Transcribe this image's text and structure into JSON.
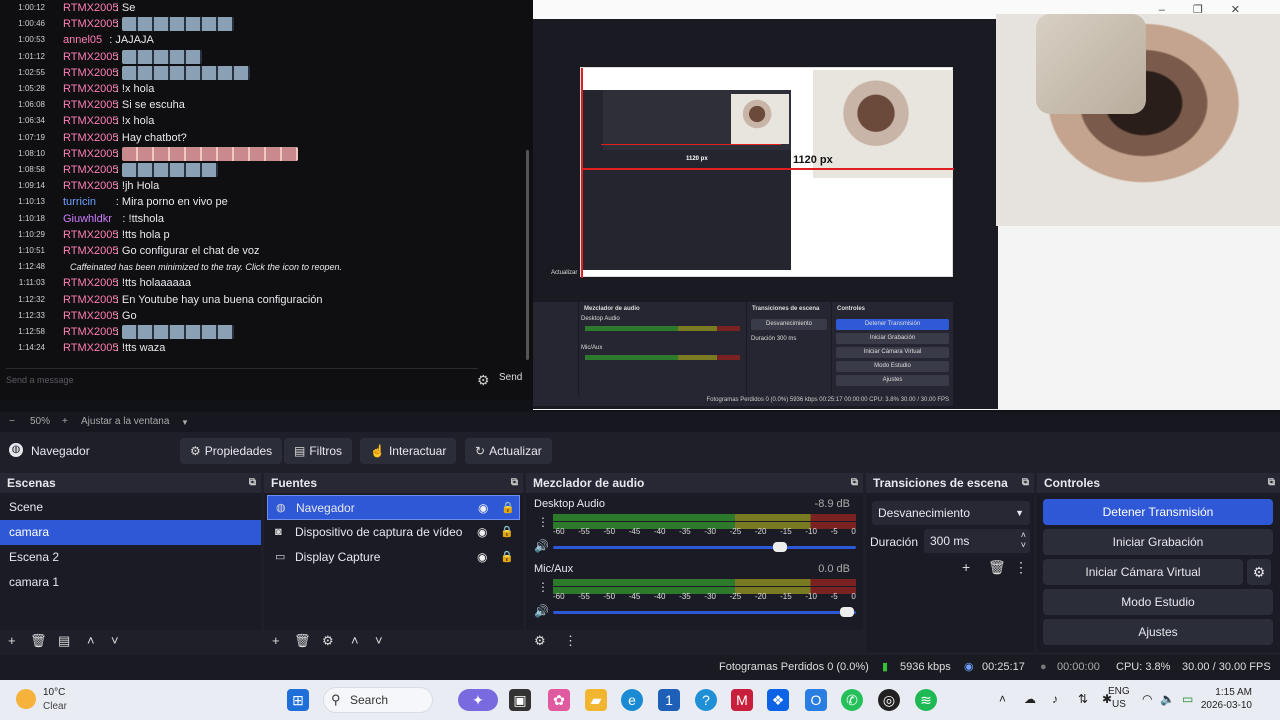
{
  "chat": {
    "lines": [
      {
        "ts": "1:00:12",
        "user": "RTMX2005",
        "msg": "Se"
      },
      {
        "ts": "1:00:46",
        "user": "RTMX2005",
        "msg": ""
      },
      {
        "ts": "1:00:53",
        "user": "annel05",
        "msg": "JAJAJA"
      },
      {
        "ts": "1:01:12",
        "user": "RTMX2005",
        "msg": ""
      },
      {
        "ts": "1:02:55",
        "user": "RTMX2005",
        "msg": ""
      },
      {
        "ts": "1:05:28",
        "user": "RTMX2005",
        "msg": "!x hola"
      },
      {
        "ts": "1:06:08",
        "user": "RTMX2005",
        "msg": "Si se escuha"
      },
      {
        "ts": "1:06:34",
        "user": "RTMX2005",
        "msg": "!x hola"
      },
      {
        "ts": "1:07:19",
        "user": "RTMX2005",
        "msg": "Hay chatbot?"
      },
      {
        "ts": "1:08:10",
        "user": "RTMX2005",
        "msg": ""
      },
      {
        "ts": "1:08:58",
        "user": "RTMX2005",
        "msg": ""
      },
      {
        "ts": "1:09:14",
        "user": "RTMX2005",
        "msg": "!jh Hola"
      },
      {
        "ts": "1:10:13",
        "user": "turricin",
        "msg": "Mira porno en vivo pe"
      },
      {
        "ts": "1:10:18",
        "user": "Giuwhldkr",
        "msg": "!ttshola"
      },
      {
        "ts": "1:10:29",
        "user": "RTMX2005",
        "msg": "!tts hola p"
      },
      {
        "ts": "1:10:51",
        "user": "RTMX2005",
        "msg": "Go configurar el chat de voz"
      },
      {
        "ts": "1:12:48",
        "user": "",
        "msg": "Caffeinated has been minimized to the tray. Click the icon to reopen."
      },
      {
        "ts": "1:11:03",
        "user": "RTMX2005",
        "msg": "!tts holaaaaaa"
      },
      {
        "ts": "1:12:32",
        "user": "RTMX2005",
        "msg": "En Youtube hay una buena configuración"
      },
      {
        "ts": "1:12:33",
        "user": "RTMX2005",
        "msg": "Go"
      },
      {
        "ts": "1:12:58",
        "user": "RTMX2005",
        "msg": ""
      },
      {
        "ts": "1:14:24",
        "user": "RTMX2005",
        "msg": "!tts waza"
      }
    ],
    "input_placeholder": "Send a message",
    "send_label": "Send"
  },
  "capture": {
    "px_label": "1120 px",
    "px_label_small": "1120 px",
    "inner_mixer": "Mezclador de audio",
    "inner_transitions": "Transiciones de escena",
    "inner_controls": "Controles",
    "inner_desktop": "Desktop Audio",
    "inner_mic": "Mic/Aux",
    "inner_fade": "Desvanecimiento",
    "inner_duration": "Duración",
    "inner_duration_val": "300 ms",
    "inner_btns": [
      "Detener Transmisión",
      "Iniciar Grabación",
      "Iniciar Cámara Virtual",
      "Modo Estudio",
      "Ajustes"
    ],
    "inner_status": "Fotogramas Perdidos 0 (0.0%)   5936 kbps   00:25:17   00:00:00   CPU: 3.8%   30.00 / 30.00 FPS",
    "inner_actualizar": "Actualizar"
  },
  "zoom": {
    "minus": "−",
    "value": "50%",
    "plus": "+",
    "fit": "Ajustar a la ventana"
  },
  "toolbar": {
    "source_name": "Navegador",
    "properties": "Propiedades",
    "filters": "Filtros",
    "interact": "Interactuar",
    "refresh": "Actualizar"
  },
  "scenes": {
    "title": "Escenas",
    "items": [
      "Scene",
      "camara",
      "Escena 2",
      "camara 1"
    ],
    "selected": 1
  },
  "sources": {
    "title": "Fuentes",
    "items": [
      {
        "name": "Navegador",
        "icon": "globe-icon"
      },
      {
        "name": "Dispositivo de captura de vídeo",
        "icon": "camera-icon"
      },
      {
        "name": "Display Capture",
        "icon": "monitor-icon"
      }
    ]
  },
  "mixer": {
    "title": "Mezclador de audio",
    "channels": [
      {
        "name": "Desktop Audio",
        "db": "-8.9 dB",
        "level": 0.75
      },
      {
        "name": "Mic/Aux",
        "db": "0.0 dB",
        "level": 0.97
      }
    ],
    "scale": [
      "-60",
      "-55",
      "-50",
      "-45",
      "-40",
      "-35",
      "-30",
      "-25",
      "-20",
      "-15",
      "-10",
      "-5",
      "0"
    ]
  },
  "transitions": {
    "title": "Transiciones de escena",
    "selected": "Desvanecimiento",
    "duration_label": "Duración",
    "duration_value": "300 ms"
  },
  "controls": {
    "title": "Controles",
    "stop_stream": "Detener Transmisión",
    "start_recording": "Iniciar Grabación",
    "start_virtual_cam": "Iniciar Cámara Virtual",
    "studio_mode": "Modo Estudio",
    "settings": "Ajustes"
  },
  "status": {
    "dropped": "Fotogramas Perdidos 0 (0.0%)",
    "bitrate": "5936 kbps",
    "stream_time": "00:25:17",
    "rec_time": "00:00:00",
    "cpu": "CPU: 3.8%",
    "fps": "30.00 / 30.00 FPS"
  },
  "taskbar": {
    "temp": "10°C",
    "condition": "Clear",
    "search": "Search",
    "lang1": "ENG",
    "lang2": "US",
    "time": "1:15 AM",
    "date": "2026-03-10",
    "badge": "1"
  },
  "colors": {
    "accent": "#2f58d6",
    "panel": "#1a1b24",
    "header": "#272833"
  }
}
